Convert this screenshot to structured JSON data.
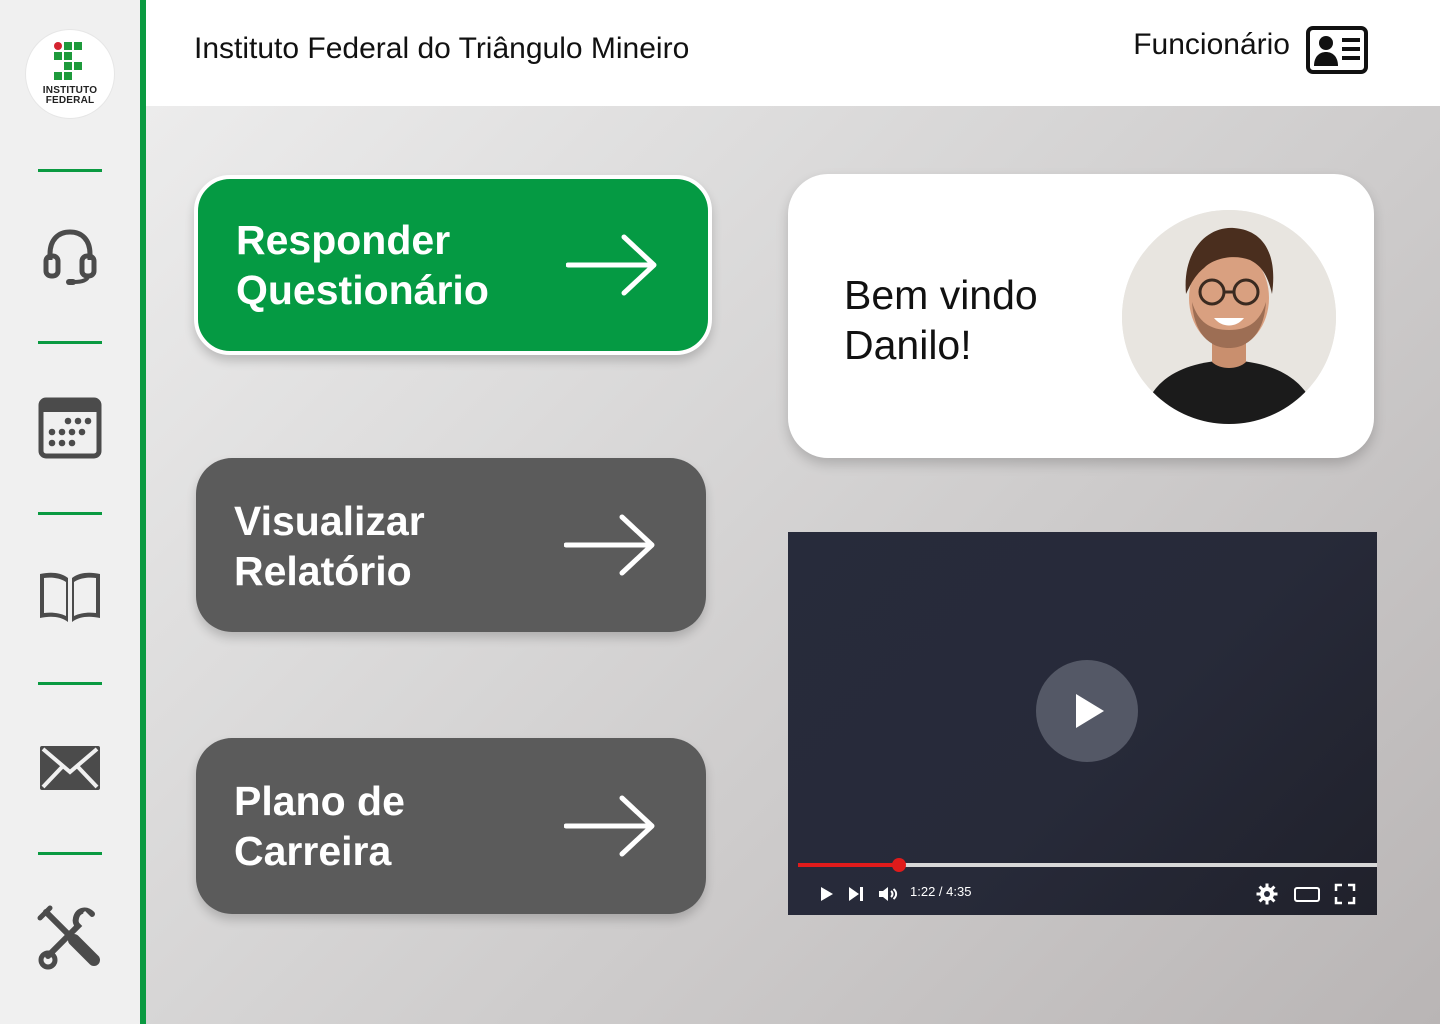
{
  "header": {
    "title": "Instituto Federal do Triângulo Mineiro",
    "role": "Funcionário"
  },
  "logo": {
    "line1": "INSTITUTO",
    "line2": "FEDERAL"
  },
  "sidebar": {
    "items": [
      {
        "icon": "headset-icon"
      },
      {
        "icon": "calendar-icon"
      },
      {
        "icon": "book-icon"
      },
      {
        "icon": "mail-icon"
      },
      {
        "icon": "tools-icon"
      }
    ]
  },
  "actions": [
    {
      "line1": "Responder",
      "line2": "Questionário",
      "style": "primary"
    },
    {
      "line1": "Visualizar",
      "line2": "Relatório",
      "style": "secondary"
    },
    {
      "line1": "Plano de",
      "line2": "Carreira",
      "style": "secondary"
    }
  ],
  "welcome": {
    "line1": "Bem vindo",
    "line2": "Danilo!"
  },
  "video": {
    "time": "1:22 / 4:35",
    "progress": 0.175
  },
  "colors": {
    "accent": "#059a43",
    "button_gray": "#5b5b5b",
    "progress": "#e01b1b"
  }
}
